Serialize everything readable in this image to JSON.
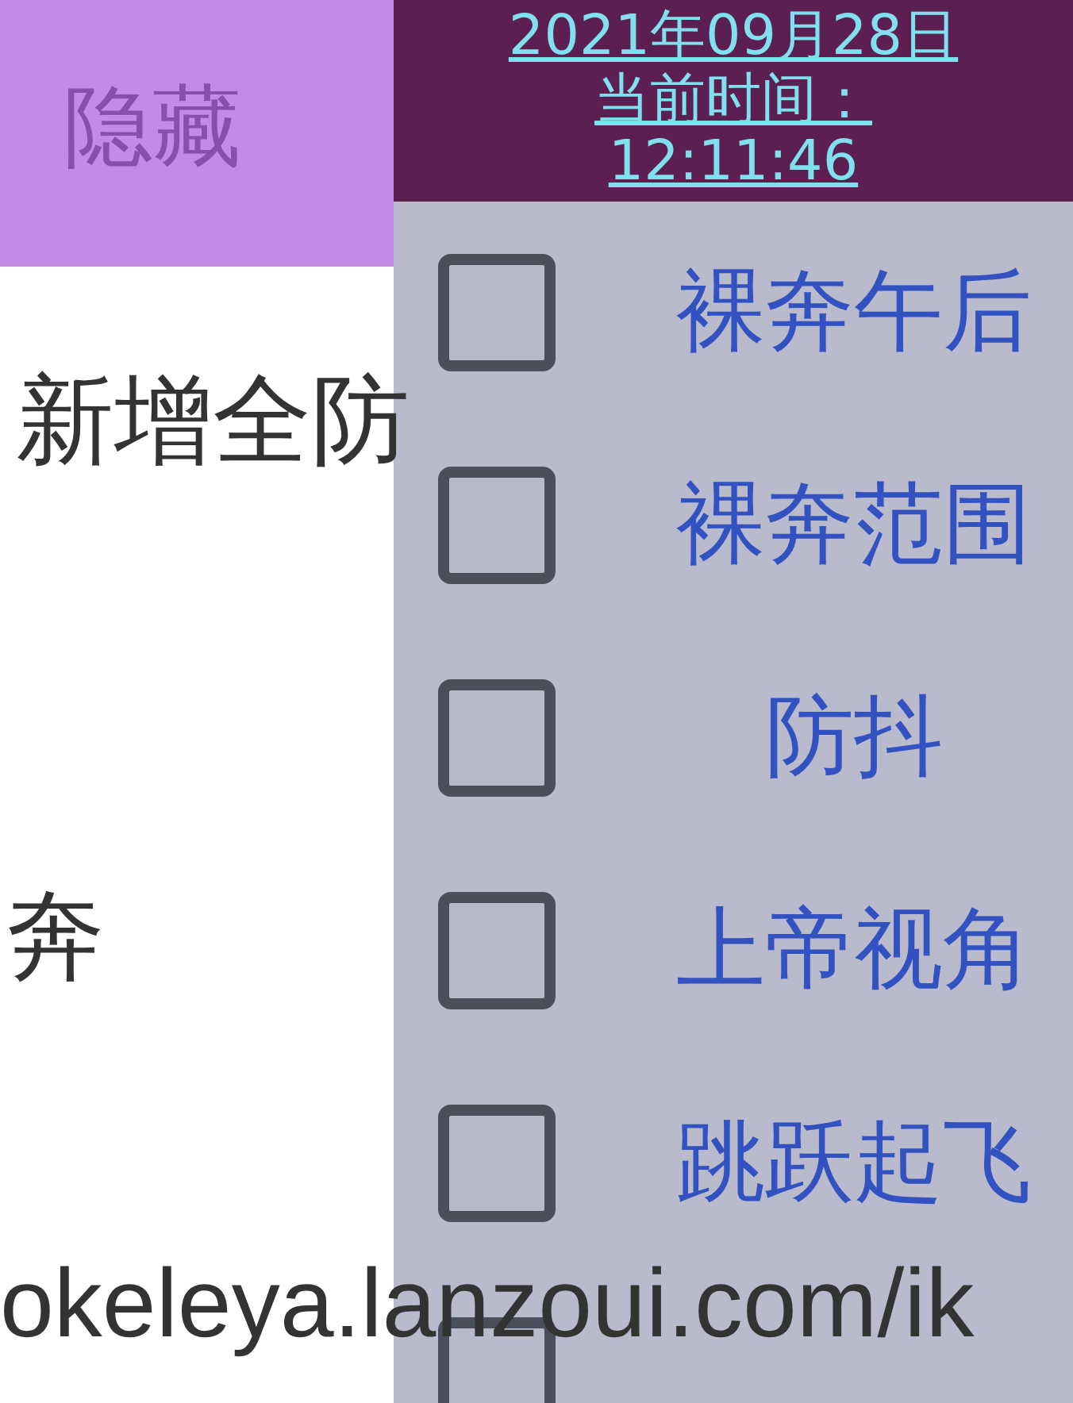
{
  "hide_button": {
    "label": "隐藏"
  },
  "menu_items": [
    {
      "label": "新增全防"
    },
    {
      "label": "奔"
    }
  ],
  "url": "okeleya.lanzoui.com/ik",
  "clock": {
    "date": "2021年09月28日",
    "time_label": "当前时间：",
    "time": "12:11:46"
  },
  "options": [
    {
      "label": "裸奔午后",
      "checked": false
    },
    {
      "label": "裸奔范围",
      "checked": false
    },
    {
      "label": "防抖",
      "checked": false
    },
    {
      "label": "上帝视角",
      "checked": false
    },
    {
      "label": "跳跃起飞",
      "checked": false
    },
    {
      "checked": false
    }
  ]
}
